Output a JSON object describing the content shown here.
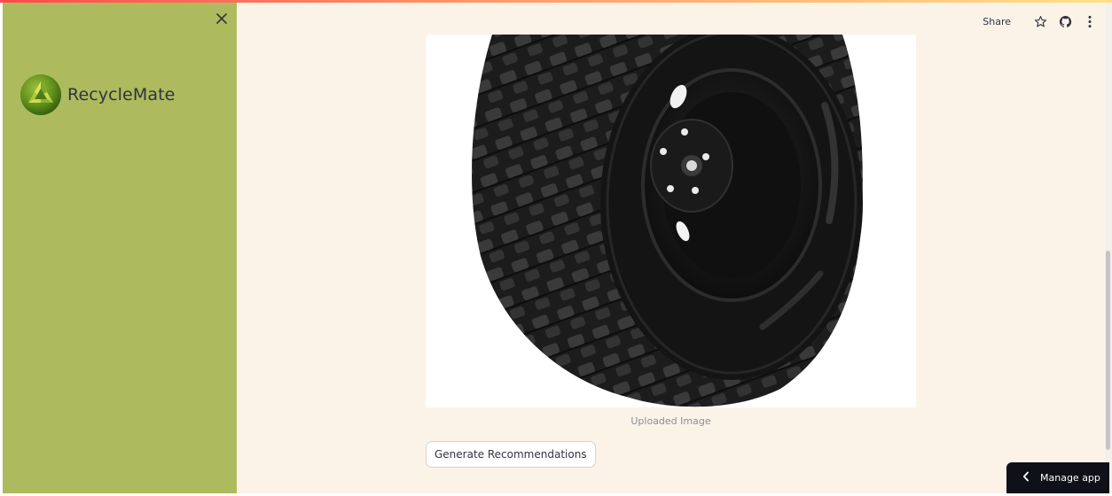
{
  "app": {
    "brand_name": "RecycleMate",
    "accent_sidebar": "#adbb5e",
    "main_background": "#fcf3e8"
  },
  "sidebar": {
    "close_icon": "close-icon",
    "logo_icon": "recycle-logo-icon"
  },
  "header": {
    "share_label": "Share",
    "icons": [
      "star-icon",
      "github-icon",
      "kebab-menu-icon"
    ]
  },
  "main": {
    "image_subject": "off-road tire with black wheel",
    "image_caption": "Uploaded Image",
    "generate_button_label": "Generate Recommendations"
  },
  "footer": {
    "manage_app_label": "Manage app",
    "manage_app_icon": "chevron-left-icon"
  }
}
